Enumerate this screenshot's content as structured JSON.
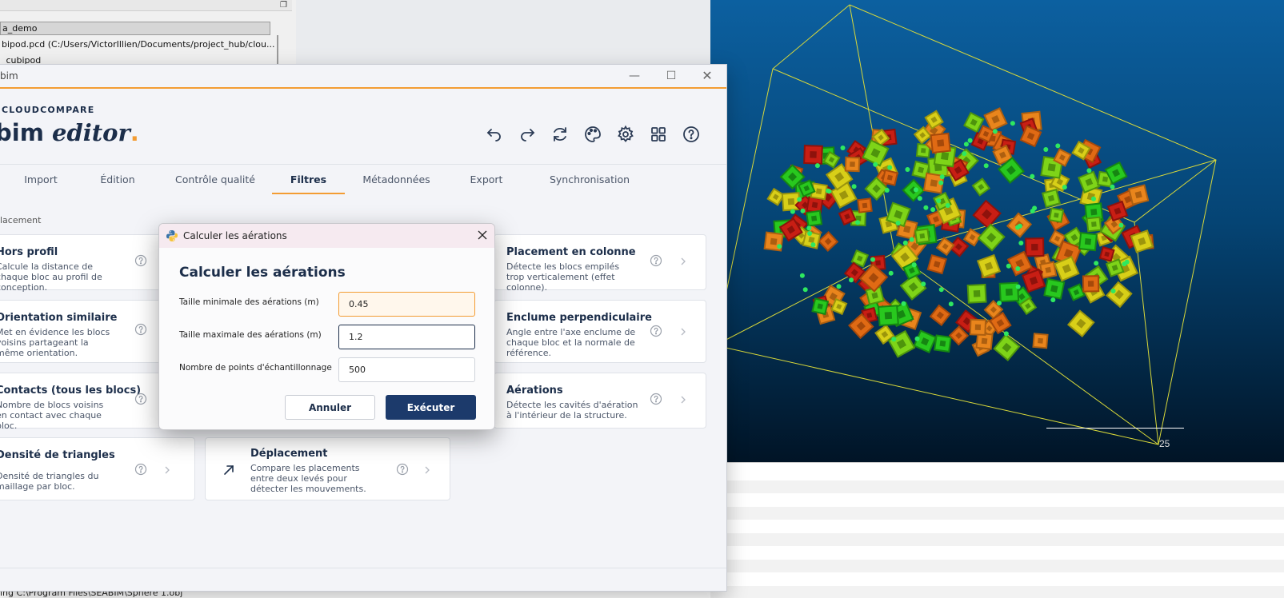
{
  "background_app": {
    "tree_rows": [
      "a_demo",
      "bipod.pcd (C:/Users/VictorIllien/Documents/project_hub/clou...",
      "_cubipod"
    ],
    "console_text": "ing C:\\Program Files\\SEABIM\\Sphere 1.obj",
    "scale_label": "25"
  },
  "window": {
    "title": "bim",
    "brand_small": "CLOUDCOMPARE",
    "brand_main": "bim ",
    "brand_italic": "editor",
    "brand_dot": ".",
    "accent_color": "#f39c33",
    "primary_color": "#1c2e4a",
    "controls": [
      "minimize-icon",
      "maximize-icon",
      "close-icon"
    ],
    "toolbar_icons": [
      "undo-icon",
      "redo-icon",
      "refresh-icon",
      "palette-icon",
      "gear-icon",
      "grid-icon",
      "help-icon"
    ]
  },
  "tabs": [
    "Import",
    "Édition",
    "Contrôle qualité",
    "Filtres",
    "Métadonnées",
    "Export",
    "Synchronisation"
  ],
  "active_tab": "Filtres",
  "section_label": "lacement",
  "cards": {
    "hors_profil": {
      "title": "Hors profil",
      "desc": "Calcule la distance de chaque bloc au profil de conception."
    },
    "orientation": {
      "title": "Orientation similaire",
      "desc": "Met en évidence les blocs voisins partageant la même orientation."
    },
    "contacts": {
      "title": "Contacts (tous les blocs)",
      "desc": "Nombre de blocs voisins en contact avec chaque bloc."
    },
    "densite": {
      "title": "Densité de triangles",
      "desc": "Densité de triangles du maillage par bloc."
    },
    "deplacement": {
      "title": "Déplacement",
      "desc": "Compare les placements entre deux levés pour détecter les mouvements."
    },
    "placement_col": {
      "title": "Placement en colonne",
      "desc": "Détecte les blocs empilés trop verticalement (effet colonne)."
    },
    "enclume": {
      "title": "Enclume perpendiculaire",
      "desc": "Angle entre l'axe enclume de chaque bloc et la normale de référence."
    },
    "aerations": {
      "title": "Aérations",
      "desc": "Détecte les cavités d'aération à l'intérieur de la structure."
    }
  },
  "dialog": {
    "title": "Calculer les aérations",
    "heading": "Calculer les aérations",
    "fields": [
      {
        "label": "Taille minimale des aérations (m)",
        "value": "0.45"
      },
      {
        "label": "Taille maximale des aérations (m)",
        "value": "1.2"
      },
      {
        "label": "Nombre de points d'échantillonnage",
        "value": "500"
      }
    ],
    "cancel_label": "Annuler",
    "run_label": "Exécuter"
  }
}
